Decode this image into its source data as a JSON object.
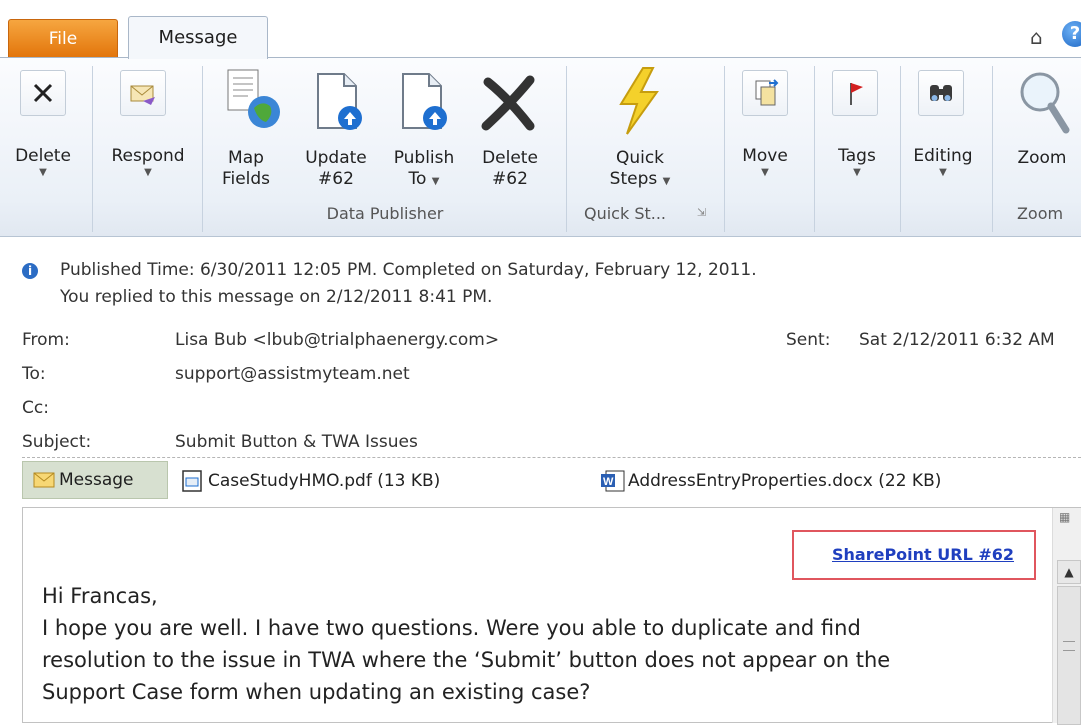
{
  "tabs": {
    "file": "File",
    "message": "Message"
  },
  "ribbon": {
    "delete": "Delete",
    "respond": "Respond",
    "map_fields": [
      "Map",
      "Fields"
    ],
    "update": [
      "Update",
      "#62"
    ],
    "publish": [
      "Publish",
      "To"
    ],
    "delete62": [
      "Delete",
      "#62"
    ],
    "data_publisher_group": "Data Publisher",
    "quick_steps": [
      "Quick",
      "Steps"
    ],
    "quick_steps_group": "Quick St...",
    "move": "Move",
    "tags": "Tags",
    "editing": "Editing",
    "zoom": "Zoom",
    "zoom_group": "Zoom",
    "help": "?"
  },
  "info": {
    "line1": "Published Time: 6/30/2011 12:05 PM.  Completed on Saturday, February 12, 2011.",
    "line2": "You replied to this message on 2/12/2011 8:41 PM."
  },
  "header": {
    "from_label": "From:",
    "from_value": "Lisa Bub <lbub@trialphaenergy.com>",
    "sent_label": "Sent:",
    "sent_value": "Sat 2/12/2011 6:32 AM",
    "to_label": "To:",
    "to_value": "support@assistmyteam.net",
    "cc_label": "Cc:",
    "subject_label": "Subject:",
    "subject_value": "Submit Button & TWA Issues"
  },
  "attachments": {
    "message": "Message",
    "pdf": "CaseStudyHMO.pdf (13 KB)",
    "docx": "AddressEntryProperties.docx (22 KB)"
  },
  "body": {
    "link": "SharePoint URL #62",
    "greeting": "Hi Francas,",
    "line1": "I hope you are well.  I have two questions.  Were you able to duplicate and find",
    "line2": "resolution to the issue in TWA where the ‘Submit’ button does not appear on the",
    "line3": "Support Case form when updating an existing case?"
  }
}
